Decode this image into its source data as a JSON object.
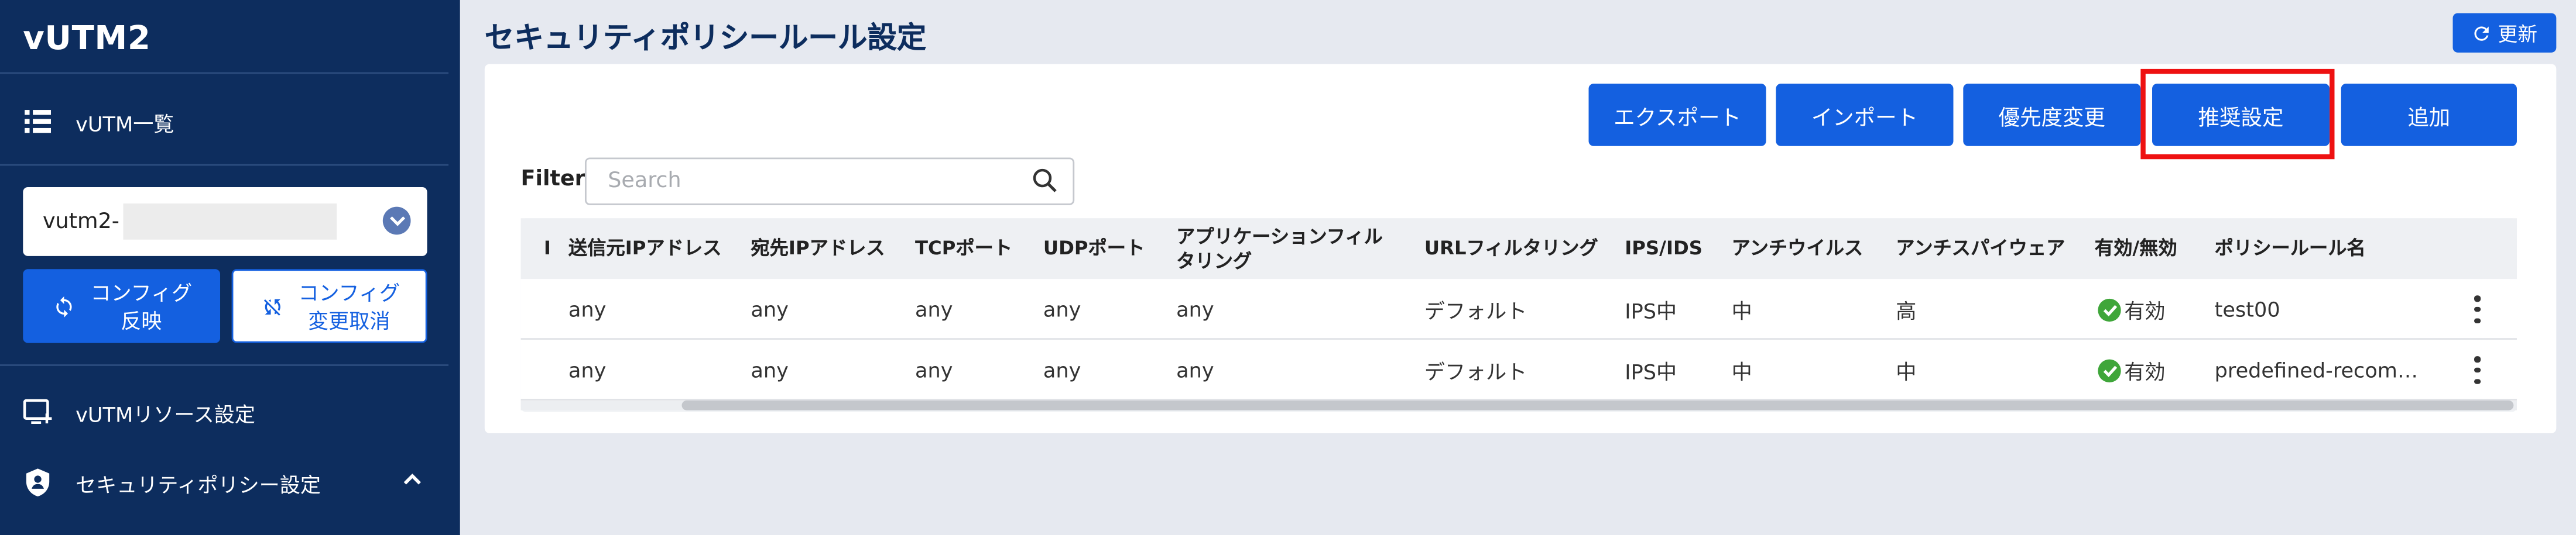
{
  "app": {
    "title": "vUTM2"
  },
  "sidebar": {
    "vutm_list": "vUTM一覧",
    "tenant_value": "vutm2-",
    "config_apply": "コンフィグ\n反映",
    "config_cancel": "コンフィグ\n変更取消",
    "resource_settings": "vUTMリソース設定",
    "security_policy_settings": "セキュリティポリシー設定"
  },
  "main": {
    "page_title": "セキュリティポリシールール設定",
    "refresh_label": "更新",
    "actions": {
      "export": "エクスポート",
      "import": "インポート",
      "priority_change": "優先度変更",
      "recommended": "推奨設定",
      "add": "追加"
    },
    "filter": {
      "label": "Filter",
      "placeholder": "Search",
      "value": ""
    }
  },
  "table": {
    "headers": {
      "sel": "I",
      "src_ip": "送信元IPアドレス",
      "dst_ip": "宛先IPアドレス",
      "tcp": "TCPポート",
      "udp": "UDPポート",
      "app": "アプリケーションフィルタリング",
      "url": "URLフィルタリング",
      "ips": "IPS/IDS",
      "av": "アンチウイルス",
      "as": "アンチスパイウェア",
      "enabled": "有効/無効",
      "name": "ポリシールール名"
    },
    "rows": [
      {
        "src_ip": "any",
        "dst_ip": "any",
        "tcp": "any",
        "udp": "any",
        "app": "any",
        "url": "デフォルト",
        "ips": "IPS中",
        "av": "中",
        "as": "高",
        "enabled": "有効",
        "name": "test00"
      },
      {
        "src_ip": "any",
        "dst_ip": "any",
        "tcp": "any",
        "udp": "any",
        "app": "any",
        "url": "デフォルト",
        "ips": "IPS中",
        "av": "中",
        "as": "中",
        "enabled": "有効",
        "name": "predefined-recom…"
      }
    ]
  },
  "colors": {
    "sidebar_bg": "#0d2d5e",
    "primary": "#1460e0",
    "highlight": "#ee1111",
    "enabled_green": "#3fa63a"
  },
  "icons": {
    "list": "list-icon",
    "chevron": "chevron-down-icon",
    "apply": "sync-icon",
    "cancel": "sync-disabled-icon",
    "resource": "add-to-queue-icon",
    "shield": "shield-icon",
    "collapse": "chevron-up-icon",
    "refresh": "refresh-icon",
    "search": "search-icon",
    "check": "check-circle-icon",
    "more": "more-vert-icon"
  }
}
